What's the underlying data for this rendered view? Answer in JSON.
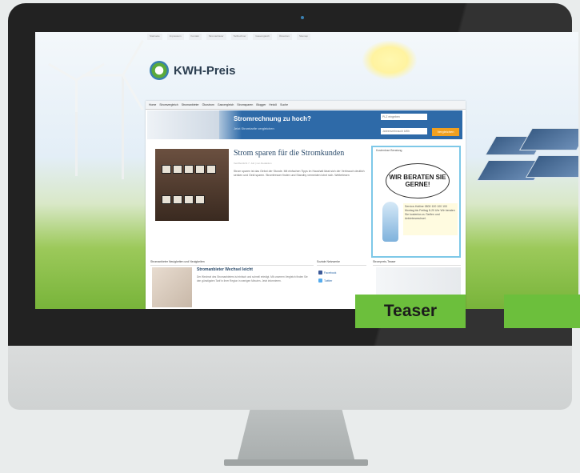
{
  "site": {
    "logo_text": "KWH-Preis",
    "top_links": [
      "Startseite",
      "Impressum",
      "Kontakt",
      "Stromanbieter",
      "Tarifrechner",
      "Gasvergleich",
      "Ökostrom",
      "Sitemap"
    ],
    "menu": [
      "Home",
      "Stromvergleich",
      "Stromanbieter",
      "Ökostrom",
      "Gasvergleich",
      "Stromsparen",
      "Blogger",
      "Heizöl",
      "Suche"
    ],
    "banner": {
      "title": "Stromrechnung zu hoch?",
      "subtitle": "Jetzt Stromtarife vergleichen",
      "input_plz": "PLZ eingeben",
      "input_kwh": "Jahresverbrauch kWh",
      "button": "Vergleichen"
    },
    "feature": {
      "title": "Strom sparen für die Stromkunden",
      "meta": "Veröffentlicht 7. Juli | von Redaktion",
      "text": "Strom sparen ist das Gebot der Stunde. Mit einfachen Tipps im Haushalt lässt sich der Verbrauch deutlich senken und Geld sparen. Stromfresser finden und Standby vermeiden lohnt sich. Weiterlesen"
    },
    "sidebox": {
      "label": "Kostenlose Beratung",
      "bubble": "WIR BERATEN SIE GERNE!",
      "contact": "Service-Hotline 0800 100 100 100 Montag bis Freitag 8-20 Uhr Wir beraten Sie kostenlos zu Tarifen und Anbieterwechsel."
    },
    "section_head": "Stromanbieter Neuigkeiten und Neuigkeiten",
    "article": {
      "title": "Stromanbieter Wechsel leicht",
      "text": "Der Wechsel des Stromanbieters ist einfach und schnell erledigt. Mit unserem Vergleich finden Sie den günstigsten Tarif in Ihrer Region in wenigen Minuten. Jetzt informieren."
    },
    "social_head": "Soziale Netzwerke",
    "social": [
      "Facebook",
      "Twitter"
    ],
    "teaser_head": "Strompreis-Teaser"
  },
  "labels": {
    "teaser": "Teaser"
  },
  "colors": {
    "tag_green": "#6cbf3c",
    "banner_blue": "#2e6aa8"
  }
}
